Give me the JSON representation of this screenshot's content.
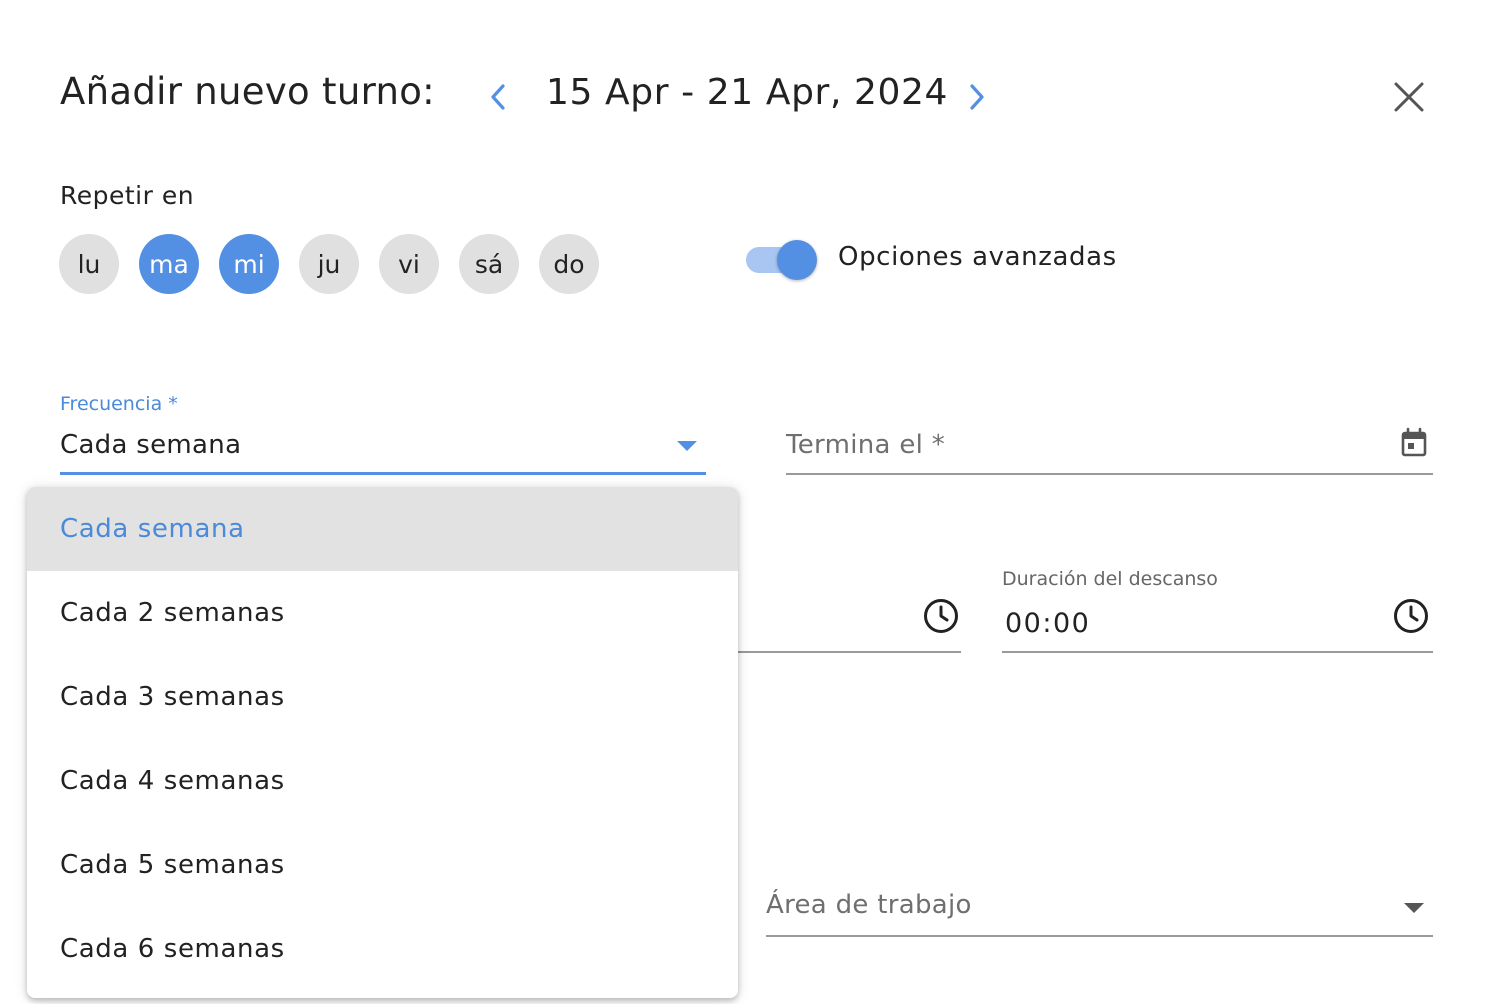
{
  "header": {
    "title": "Añadir nuevo turno:",
    "date_range": "15 Apr - 21 Apr, 2024"
  },
  "repeat": {
    "label": "Repetir en",
    "days": [
      {
        "label": "lu",
        "selected": false
      },
      {
        "label": "ma",
        "selected": true
      },
      {
        "label": "mi",
        "selected": true
      },
      {
        "label": "ju",
        "selected": false
      },
      {
        "label": "vi",
        "selected": false
      },
      {
        "label": "sá",
        "selected": false
      },
      {
        "label": "do",
        "selected": false
      }
    ]
  },
  "advanced": {
    "label": "Opciones avanzadas",
    "enabled": true
  },
  "frequency": {
    "label": "Frecuencia *",
    "value": "Cada semana",
    "options": [
      "Cada semana",
      "Cada 2 semanas",
      "Cada 3 semanas",
      "Cada 4 semanas",
      "Cada 5 semanas",
      "Cada 6 semanas"
    ]
  },
  "end_date": {
    "label": "Termina el *"
  },
  "break_duration": {
    "label": "Duración del descanso",
    "value": "00:00"
  },
  "work_area": {
    "label": "Área de trabajo"
  },
  "colors": {
    "accent": "#5390e4",
    "accent_light": "#a8c6f1",
    "chip_bg": "#e0e0e0",
    "selected_row": "#e2e2e2"
  },
  "icons": {
    "prev": "chevron-left-icon",
    "next": "chevron-right-icon",
    "close": "close-icon",
    "calendar": "calendar-icon",
    "clock": "clock-icon"
  }
}
